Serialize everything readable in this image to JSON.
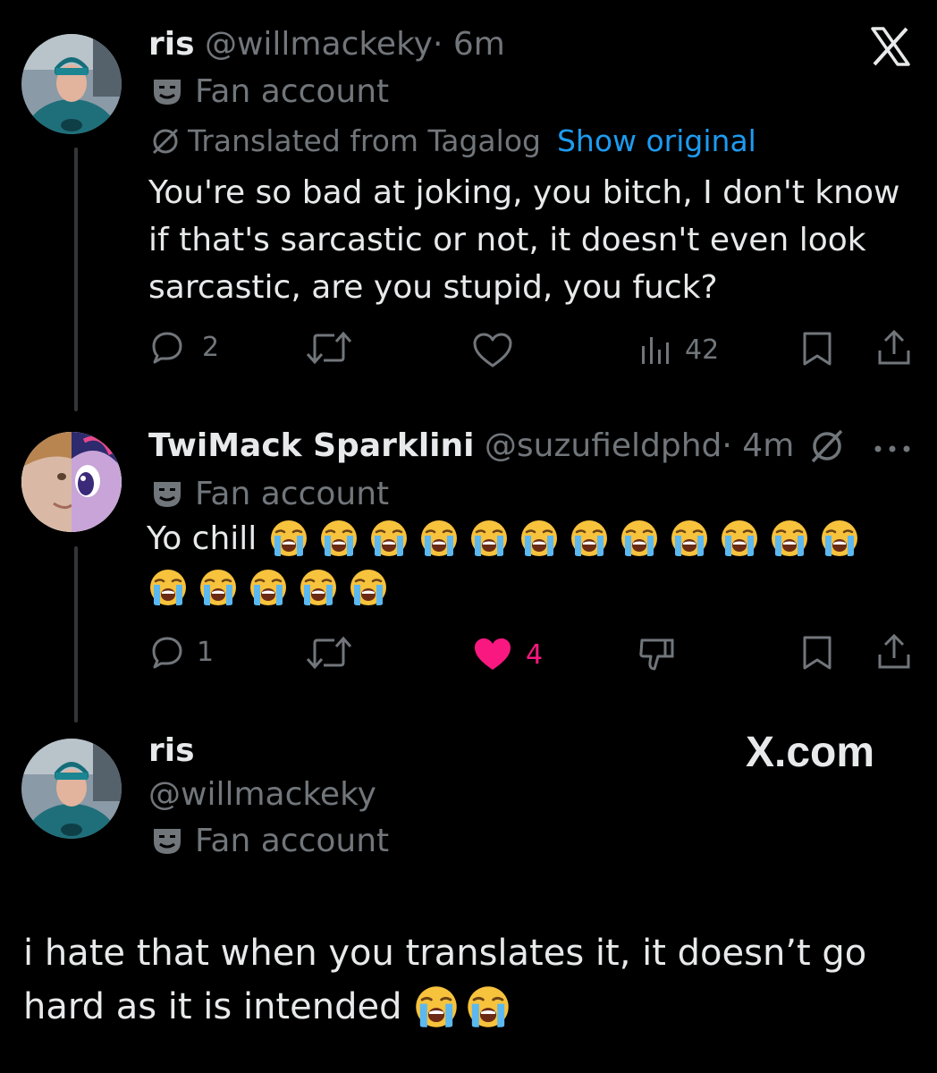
{
  "tweet1": {
    "name": "ris",
    "handle": "@willmackeky",
    "time": "· 6m",
    "badge": "Fan account",
    "translated": "Translated from Tagalog",
    "show_original": "Show original",
    "text_lines": [
      "You're so bad at joking, you bitch, I don't know",
      "if that's sarcastic or not, it doesn't even look",
      "sarcastic, are you stupid, you fuck?"
    ],
    "replies": "2",
    "views": "42"
  },
  "tweet2": {
    "name": "TwiMack Sparklini",
    "handle": "@suzufieldphd",
    "time": "· 4m",
    "badge": "Fan account",
    "text": "Yo chill",
    "emoji_name": "loudly-crying-face",
    "emoji_count_line1": 12,
    "emoji_count_line2": 5,
    "replies": "1",
    "likes": "4"
  },
  "profile": {
    "name": "ris",
    "handle": "@willmackeky",
    "badge": "Fan account",
    "brand": "X.com"
  },
  "caption": {
    "line1": "i hate that when you translates it, it doesn’t go",
    "line2": "hard as it is intended",
    "emoji_count": 2
  },
  "colors": {
    "background": "#000000",
    "text": "#e7e9ea",
    "muted": "#71767b",
    "link": "#1d9bf0",
    "like": "#f91880"
  }
}
